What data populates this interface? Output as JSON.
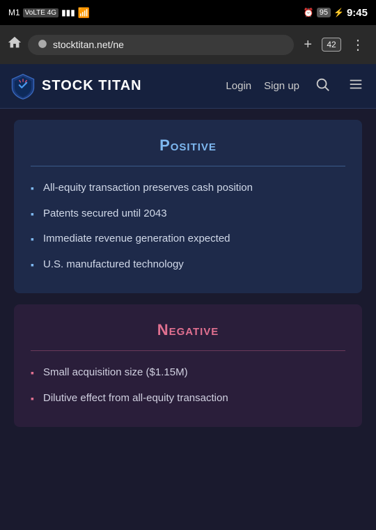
{
  "statusBar": {
    "carrier": "M1",
    "network": "VoLTE 4G",
    "time": "9:45",
    "battery": "95",
    "alarm_icon": "⏰"
  },
  "browser": {
    "url": "stocktitan.net/ne",
    "tabs_count": "42",
    "home_icon": "⌂",
    "plus_icon": "+",
    "more_icon": "⋮"
  },
  "navbar": {
    "logo_text": "STOCK TITAN",
    "login_label": "Login",
    "signup_label": "Sign up",
    "search_icon": "🔍",
    "menu_icon": "☰"
  },
  "positive": {
    "title": "Positive",
    "divider": true,
    "items": [
      "All-equity transaction preserves cash position",
      "Patents secured until 2043",
      "Immediate revenue generation expected",
      "U.S. manufactured technology"
    ]
  },
  "negative": {
    "title": "Negative",
    "divider": true,
    "items": [
      "Small acquisition size ($1.15M)",
      "Dilutive effect from all-equity transaction"
    ]
  }
}
